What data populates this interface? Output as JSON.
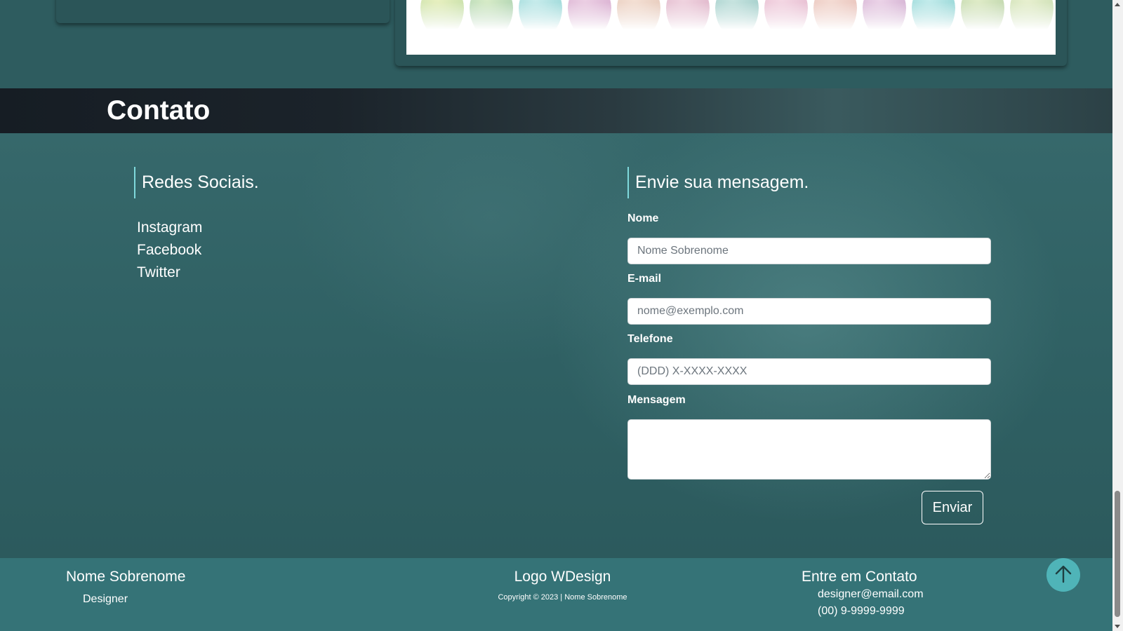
{
  "contact": {
    "title": "Contato",
    "social": {
      "heading": "Redes Sociais.",
      "links": [
        "Instagram",
        "Facebook",
        "Twitter"
      ]
    },
    "form": {
      "heading": "Envie sua mensagem.",
      "name_label": "Nome",
      "name_placeholder": "Nome Sobrenome",
      "email_label": "E-mail",
      "email_placeholder": "nome@exemplo.com",
      "phone_label": "Telefone",
      "phone_placeholder": "(DDD) X-XXXX-XXXX",
      "message_label": "Mensagem",
      "message_value": "",
      "submit_label": "Enviar"
    }
  },
  "footer": {
    "name": "Nome Sobrenome",
    "role": "Designer",
    "logo": "Logo WDesign",
    "copyright": "Copyright © 2023 | Nome Sobrenome",
    "contact_title": "Entre em Contato",
    "email": "designer@email.com",
    "phone": "(00) 9-9999-9999"
  },
  "colors": {
    "page_background": "#2f5d60",
    "header_dark": "#1b232a",
    "heading_accent": "#7fd9dc",
    "footer_background": "#357377",
    "back_to_top_button": "#4fb4b8"
  },
  "icons": {
    "back_to_top": "arrow-up-icon"
  }
}
